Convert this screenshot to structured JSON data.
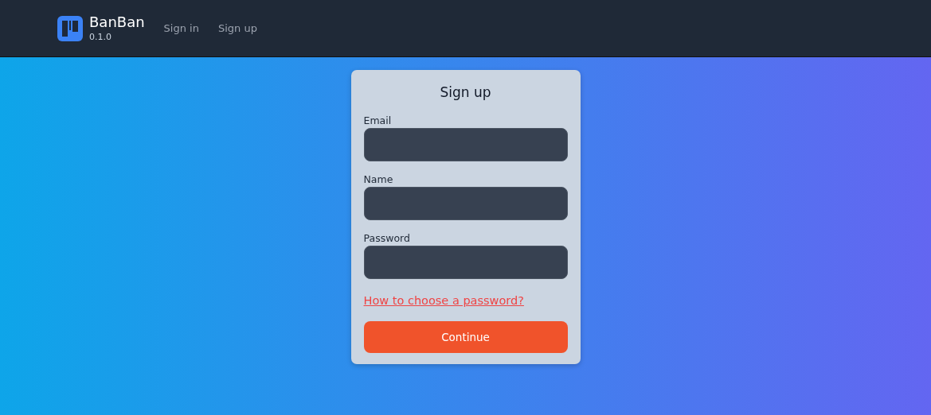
{
  "header": {
    "brand": "BanBan",
    "version": "0.1.0",
    "nav": [
      {
        "label": "Sign in"
      },
      {
        "label": "Sign up"
      }
    ]
  },
  "form": {
    "title": "Sign up",
    "fields": [
      {
        "label": "Email"
      },
      {
        "label": "Name"
      },
      {
        "label": "Password"
      }
    ],
    "link": "How to choose a password?",
    "submit": "Continue"
  }
}
